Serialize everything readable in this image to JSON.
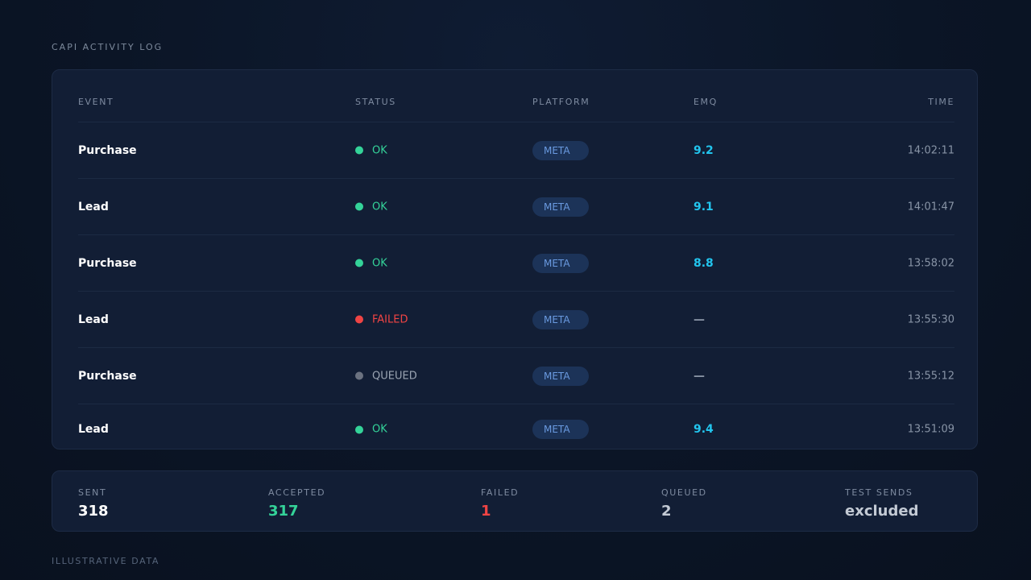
{
  "page": {
    "title": "CAPI ACTIVITY LOG",
    "footer_note": "ILLUSTRATIVE DATA"
  },
  "table": {
    "columns": {
      "event": "EVENT",
      "status": "STATUS",
      "platform": "PLATFORM",
      "emq": "EMQ",
      "time": "TIME"
    },
    "rows": [
      {
        "event": "Purchase",
        "status": "OK",
        "status_color": "#34d399",
        "dot_color": "#34d399",
        "platform": "META",
        "emq": "9.2",
        "emq_color": "#22c5ee",
        "time": "14:02:11"
      },
      {
        "event": "Lead",
        "status": "OK",
        "status_color": "#34d399",
        "dot_color": "#34d399",
        "platform": "META",
        "emq": "9.1",
        "emq_color": "#22c5ee",
        "time": "14:01:47"
      },
      {
        "event": "Purchase",
        "status": "OK",
        "status_color": "#34d399",
        "dot_color": "#34d399",
        "platform": "META",
        "emq": "8.8",
        "emq_color": "#22c5ee",
        "time": "13:58:02"
      },
      {
        "event": "Lead",
        "status": "FAILED",
        "status_color": "#f04444",
        "dot_color": "#ef4444",
        "platform": "META",
        "emq": "—",
        "emq_color": "#8a95a6",
        "time": "13:55:30"
      },
      {
        "event": "Purchase",
        "status": "QUEUED",
        "status_color": "#9aa4b2",
        "dot_color": "#6b7280",
        "platform": "META",
        "emq": "—",
        "emq_color": "#8a95a6",
        "time": "13:55:12"
      },
      {
        "event": "Lead",
        "status": "OK",
        "status_color": "#34d399",
        "dot_color": "#34d399",
        "platform": "META",
        "emq": "9.4",
        "emq_color": "#22c5ee",
        "time": "13:51:09"
      }
    ]
  },
  "summary": [
    {
      "label": "SENT",
      "value": "318",
      "color": "#ffffff"
    },
    {
      "label": "ACCEPTED",
      "value": "317",
      "color": "#34d399"
    },
    {
      "label": "FAILED",
      "value": "1",
      "color": "#f04444"
    },
    {
      "label": "QUEUED",
      "value": "2",
      "color": "#c3cad4"
    },
    {
      "label": "TEST SENDS",
      "value": "excluded",
      "color": "#c3cad4"
    }
  ]
}
